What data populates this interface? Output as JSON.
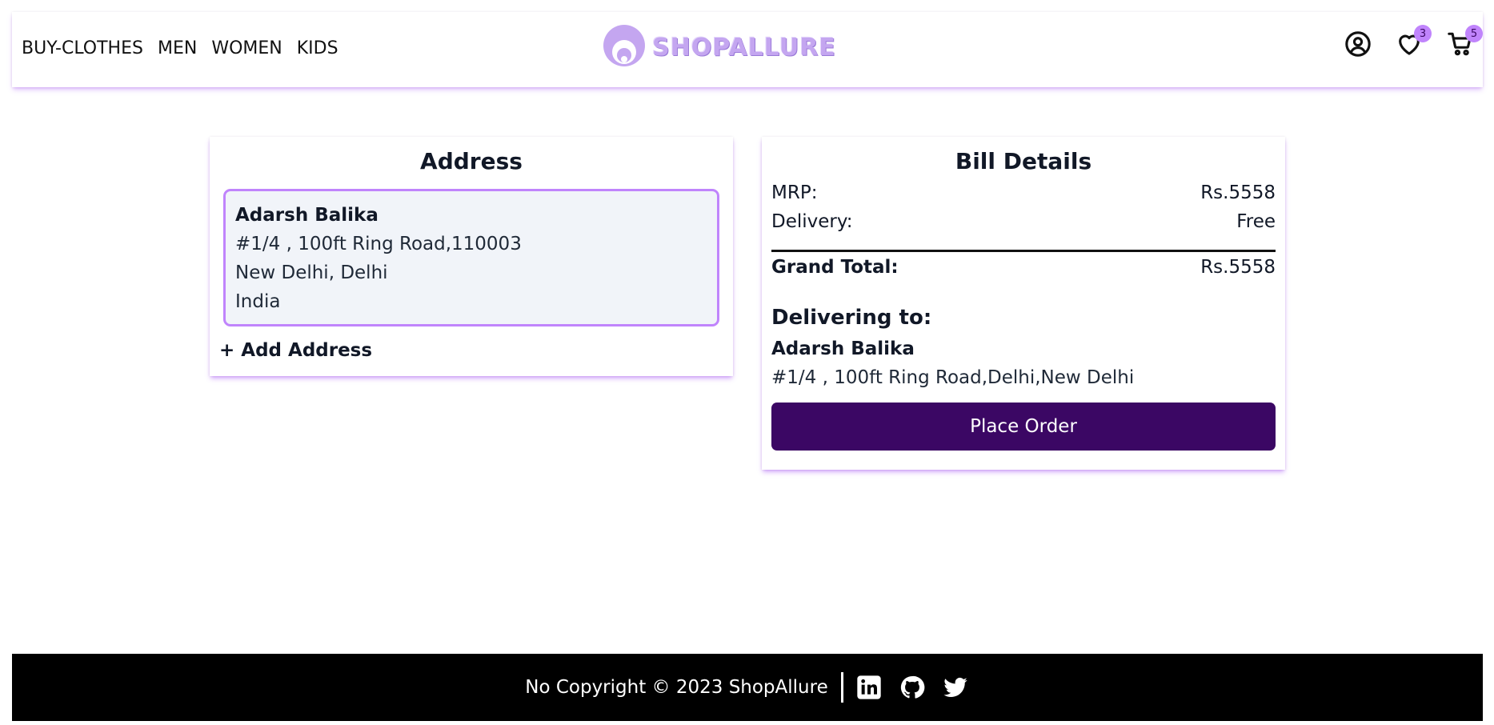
{
  "nav": {
    "items": [
      "BUY-CLOTHES",
      "MEN",
      "WOMEN",
      "KIDS"
    ]
  },
  "brand": {
    "name": "SHOPALLURE",
    "color": "#c4a6f0"
  },
  "header_icons": {
    "profile": "user-circle-icon",
    "wishlist": "heart-icon",
    "wishlist_count": "3",
    "cart": "cart-icon",
    "cart_count": "5"
  },
  "address_card": {
    "title": "Address",
    "selected_address": {
      "name": "Adarsh Balika",
      "line1": "#1/4 , 100ft Ring Road,110003",
      "line2": "New Delhi, Delhi",
      "country": "India"
    },
    "add_address_label": "+ Add Address"
  },
  "bill_card": {
    "title": "Bill Details",
    "mrp_label": "MRP:",
    "mrp_value": "Rs.5558",
    "delivery_label": "Delivery:",
    "delivery_value": "Free",
    "grand_total_label": "Grand Total:",
    "grand_total_value": "Rs.5558",
    "delivering_to_label": "Delivering to:",
    "delivering_name": "Adarsh Balika",
    "delivering_address": "#1/4 , 100ft Ring Road,Delhi,New Delhi",
    "place_order_label": "Place Order"
  },
  "footer": {
    "copyright": "No Copyright © 2023 ShopAllure",
    "icons": [
      "linkedin-icon",
      "github-icon",
      "twitter-icon"
    ]
  },
  "colors": {
    "accent": "#c084fc",
    "primary_button": "#3b0764",
    "address_box_bg": "#f1f4f9",
    "footer_bg": "#000000"
  }
}
